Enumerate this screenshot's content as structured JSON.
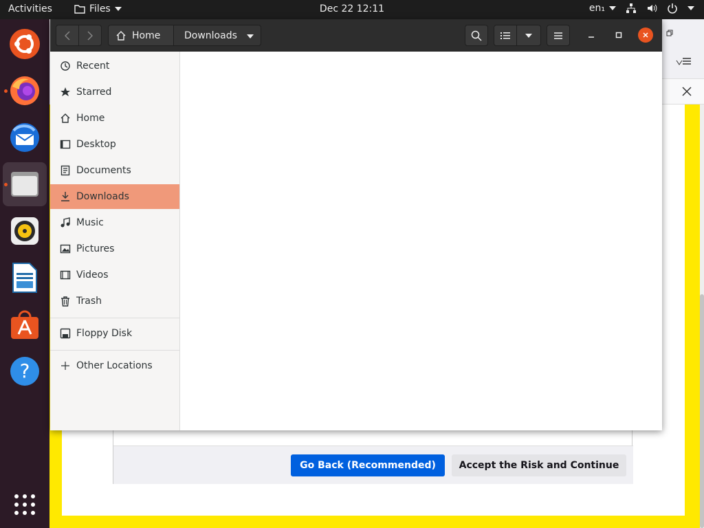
{
  "topbar": {
    "activities": "Activities",
    "app_name": "Files",
    "clock": "Dec 22  12:11",
    "lang": "en₁"
  },
  "dock": {
    "items": [
      "ubuntu-software-icon",
      "firefox-icon",
      "thunderbird-icon",
      "files-icon",
      "rhythmbox-icon",
      "libreoffice-writer-icon",
      "app-center-icon",
      "help-icon",
      "show-apps-icon"
    ]
  },
  "files": {
    "path": {
      "home": "Home",
      "current": "Downloads"
    },
    "sidebar": {
      "items": [
        {
          "label": "Recent",
          "icon": "clock-icon"
        },
        {
          "label": "Starred",
          "icon": "star-icon"
        },
        {
          "label": "Home",
          "icon": "home-icon"
        },
        {
          "label": "Desktop",
          "icon": "desktop-icon"
        },
        {
          "label": "Documents",
          "icon": "document-icon"
        },
        {
          "label": "Downloads",
          "icon": "download-icon"
        },
        {
          "label": "Music",
          "icon": "music-icon"
        },
        {
          "label": "Pictures",
          "icon": "picture-icon"
        },
        {
          "label": "Videos",
          "icon": "video-icon"
        },
        {
          "label": "Trash",
          "icon": "trash-icon"
        },
        {
          "label": "Floppy Disk",
          "icon": "floppy-icon"
        },
        {
          "label": "Other Locations",
          "icon": "plus-icon"
        }
      ],
      "selected": "Downloads"
    }
  },
  "browser": {
    "warning_dialog": {
      "back_button": "Go Back (Recommended)",
      "accept_button": "Accept the Risk and Continue"
    }
  },
  "colors": {
    "accent": "#e95420",
    "selected_row": "#f0997a",
    "primary_button": "#0060df",
    "warning_border": "#ffe900"
  }
}
